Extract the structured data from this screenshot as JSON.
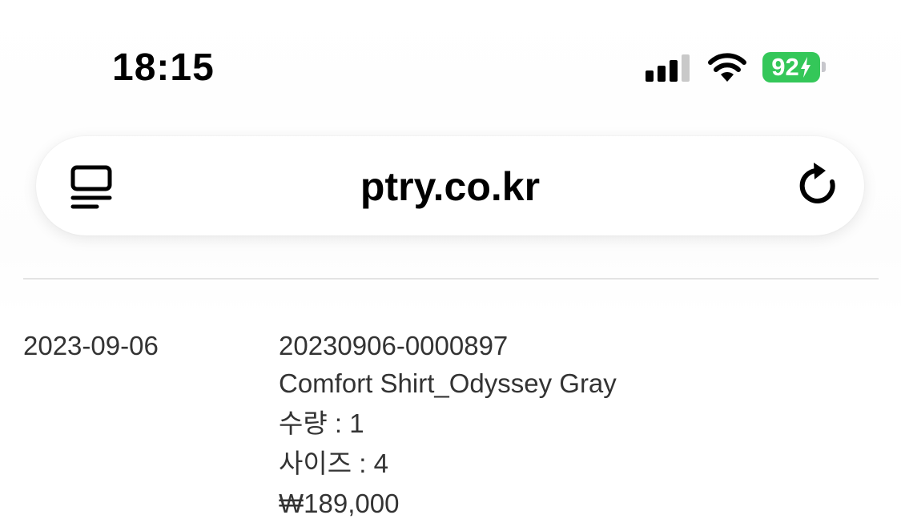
{
  "status_bar": {
    "time": "18:15",
    "battery_level": "92",
    "battery_color": "#34c759",
    "icons": [
      "signal-icon",
      "wifi-icon",
      "battery-icon",
      "charging-bolt-icon"
    ]
  },
  "url_bar": {
    "url": "ptry.co.kr",
    "left_icon": "reader-mode-icon",
    "right_icon": "reload-icon"
  },
  "order": {
    "date": "2023-09-06",
    "order_number": "20230906-0000897",
    "product_name": "Comfort Shirt_Odyssey Gray",
    "quantity": "수량 : 1",
    "size": "사이즈 : 4",
    "price": "₩189,000"
  }
}
